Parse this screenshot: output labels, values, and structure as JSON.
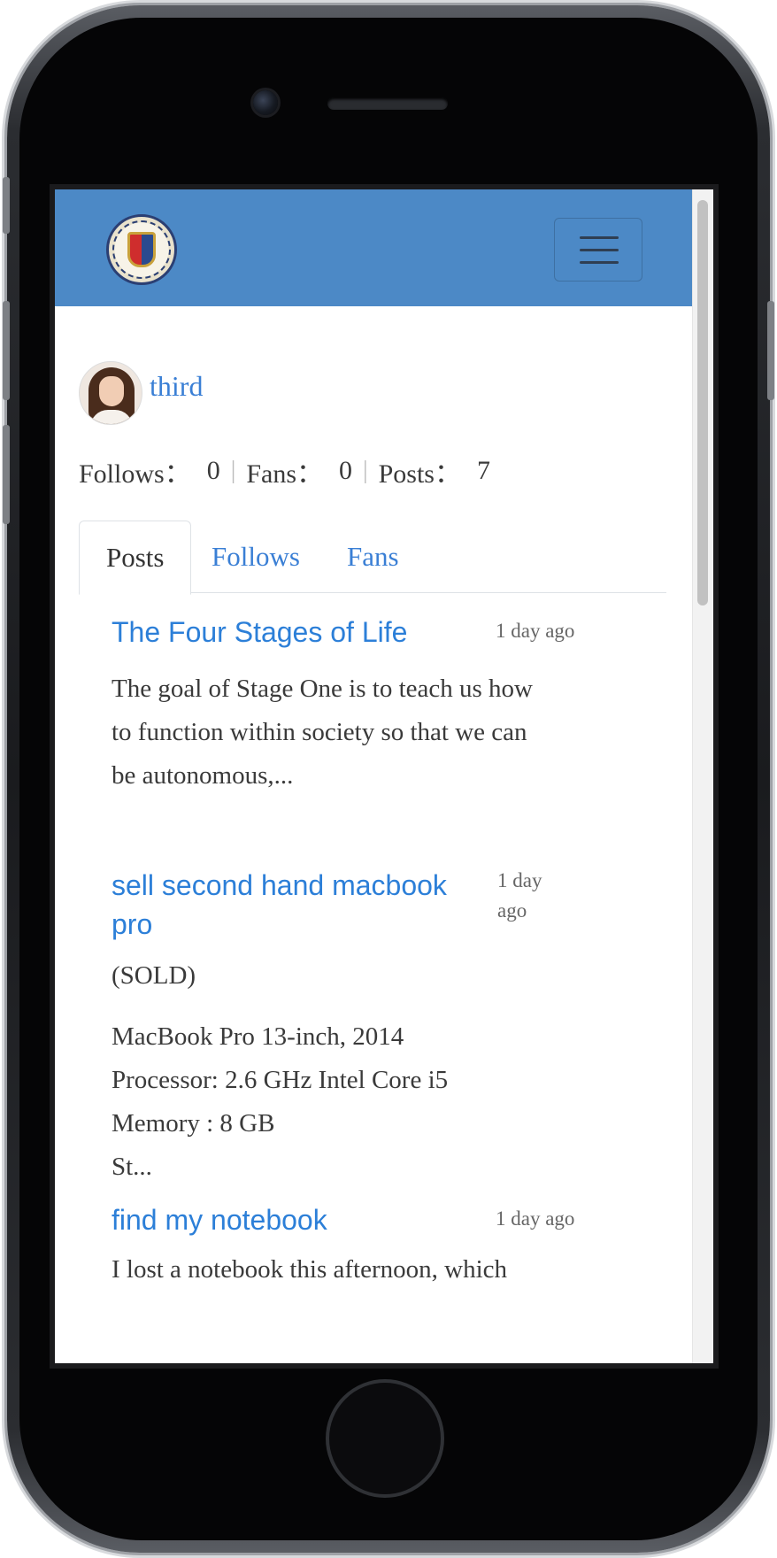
{
  "navbar": {
    "logo_icon": "university-seal-logo",
    "menu_icon": "hamburger-menu-icon"
  },
  "profile": {
    "username": "third"
  },
  "stats": {
    "follows_label": "Follows：",
    "follows_value": "0",
    "fans_label": "Fans：",
    "fans_value": "0",
    "posts_label": "Posts：",
    "posts_value": "7",
    "separator": "|"
  },
  "tabs": [
    {
      "label": "Posts",
      "active": true
    },
    {
      "label": "Follows",
      "active": false
    },
    {
      "label": "Fans",
      "active": false
    }
  ],
  "posts": [
    {
      "title": "The Four Stages of Life",
      "time": "1 day ago",
      "body": [
        "The goal of Stage One is to teach us how",
        "to function within society so that we can",
        "be autonomous,..."
      ]
    },
    {
      "title_lines": [
        "sell second hand macbook",
        "pro"
      ],
      "time_lines": [
        "1 day",
        "ago"
      ],
      "body": [
        "(SOLD)",
        "",
        "MacBook Pro 13-inch, 2014",
        "Processor: 2.6 GHz Intel Core i5",
        "Memory : 8 GB",
        "St..."
      ]
    },
    {
      "title": "find my notebook",
      "time": "1 day ago",
      "body": [
        "I lost a notebook this afternoon, which"
      ]
    }
  ]
}
